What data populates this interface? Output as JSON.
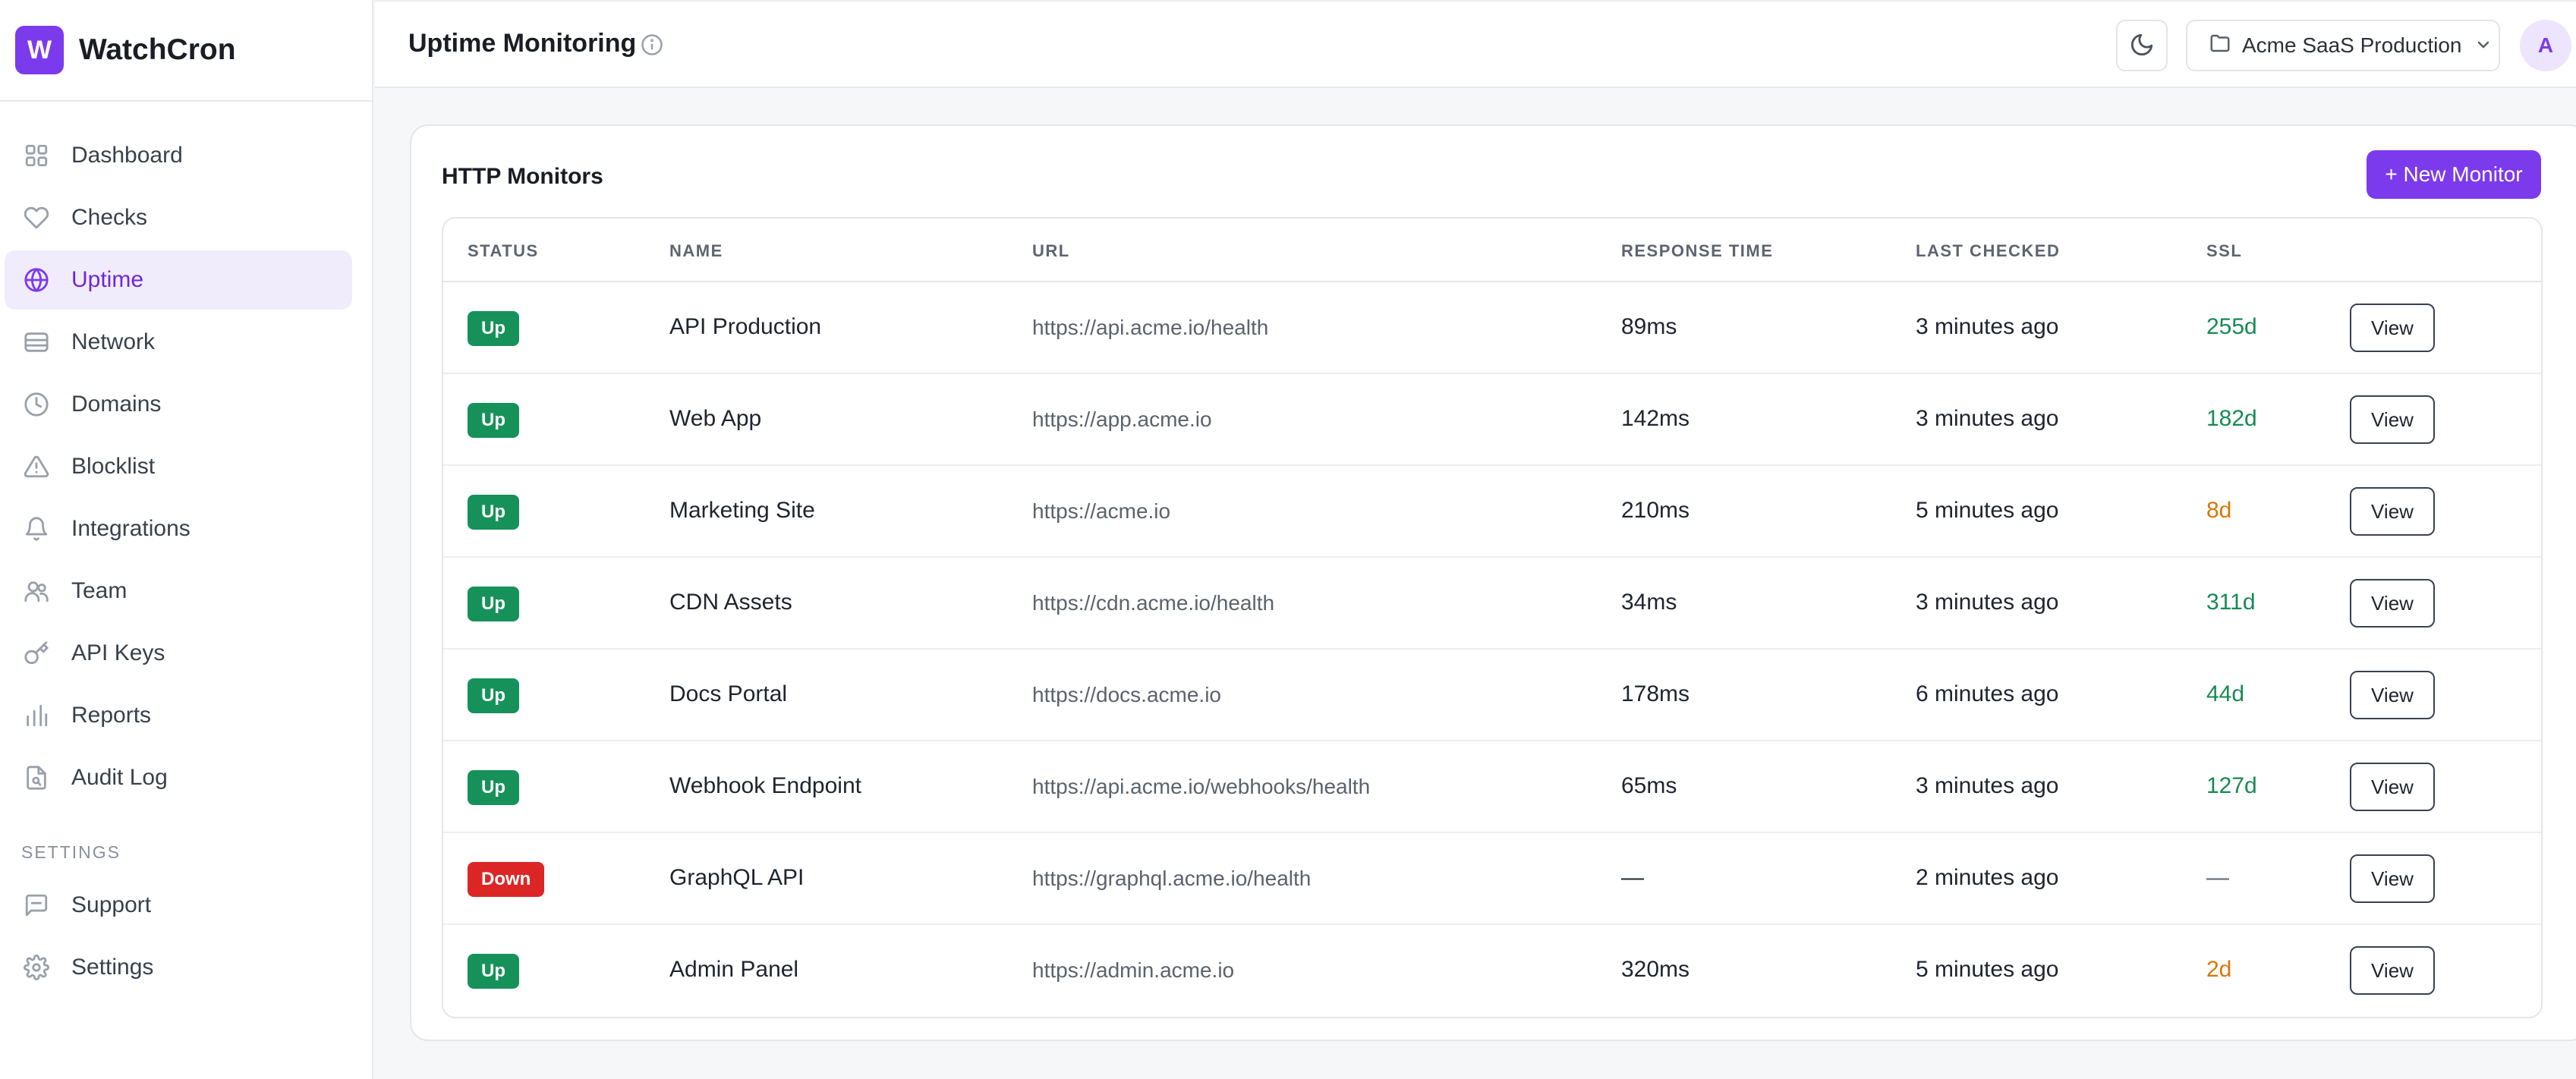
{
  "app": {
    "logo_letter": "W",
    "name": "WatchCron"
  },
  "sidebar": {
    "items": [
      {
        "label": "Dashboard",
        "icon": "grid-icon",
        "active": false
      },
      {
        "label": "Checks",
        "icon": "heart-icon",
        "active": false
      },
      {
        "label": "Uptime",
        "icon": "globe-icon",
        "active": true
      },
      {
        "label": "Network",
        "icon": "server-icon",
        "active": false
      },
      {
        "label": "Domains",
        "icon": "clock-icon",
        "active": false
      },
      {
        "label": "Blocklist",
        "icon": "warning-icon",
        "active": false
      },
      {
        "label": "Integrations",
        "icon": "bell-icon",
        "active": false
      },
      {
        "label": "Team",
        "icon": "users-icon",
        "active": false
      },
      {
        "label": "API Keys",
        "icon": "key-icon",
        "active": false
      },
      {
        "label": "Reports",
        "icon": "bar-chart-icon",
        "active": false
      },
      {
        "label": "Audit Log",
        "icon": "file-search-icon",
        "active": false
      }
    ],
    "settings_heading": "SETTINGS",
    "settings_items": [
      {
        "label": "Support",
        "icon": "chat-icon"
      },
      {
        "label": "Settings",
        "icon": "gear-icon"
      }
    ]
  },
  "header": {
    "title": "Uptime Monitoring",
    "workspace": "Acme SaaS Production",
    "avatar_initial": "A"
  },
  "card": {
    "title": "HTTP Monitors",
    "new_button": "+ New Monitor"
  },
  "table": {
    "columns": [
      "STATUS",
      "NAME",
      "URL",
      "RESPONSE TIME",
      "LAST CHECKED",
      "SSL"
    ],
    "view_label": "View",
    "rows": [
      {
        "status": "Up",
        "name": "API Production",
        "url": "https://api.acme.io/health",
        "response": "89ms",
        "last_checked": "3 minutes ago",
        "ssl": "255d",
        "ssl_level": "green"
      },
      {
        "status": "Up",
        "name": "Web App",
        "url": "https://app.acme.io",
        "response": "142ms",
        "last_checked": "3 minutes ago",
        "ssl": "182d",
        "ssl_level": "green"
      },
      {
        "status": "Up",
        "name": "Marketing Site",
        "url": "https://acme.io",
        "response": "210ms",
        "last_checked": "5 minutes ago",
        "ssl": "8d",
        "ssl_level": "orange"
      },
      {
        "status": "Up",
        "name": "CDN Assets",
        "url": "https://cdn.acme.io/health",
        "response": "34ms",
        "last_checked": "3 minutes ago",
        "ssl": "311d",
        "ssl_level": "green"
      },
      {
        "status": "Up",
        "name": "Docs Portal",
        "url": "https://docs.acme.io",
        "response": "178ms",
        "last_checked": "6 minutes ago",
        "ssl": "44d",
        "ssl_level": "green"
      },
      {
        "status": "Up",
        "name": "Webhook Endpoint",
        "url": "https://api.acme.io/webhooks/health",
        "response": "65ms",
        "last_checked": "3 minutes ago",
        "ssl": "127d",
        "ssl_level": "green"
      },
      {
        "status": "Down",
        "name": "GraphQL API",
        "url": "https://graphql.acme.io/health",
        "response": "—",
        "last_checked": "2 minutes ago",
        "ssl": "—",
        "ssl_level": "none"
      },
      {
        "status": "Up",
        "name": "Admin Panel",
        "url": "https://admin.acme.io",
        "response": "320ms",
        "last_checked": "5 minutes ago",
        "ssl": "2d",
        "ssl_level": "orange"
      }
    ]
  },
  "colors": {
    "accent": "#7c3aed",
    "status_up": "#16915a",
    "status_down": "#dc2626",
    "ssl_ok": "#178a54",
    "ssl_warning": "#d97706"
  }
}
